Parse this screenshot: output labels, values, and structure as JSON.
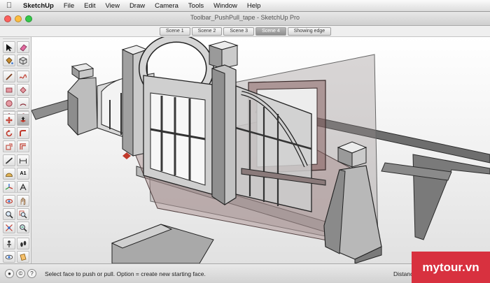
{
  "menubar": {
    "app": "SketchUp",
    "items": [
      {
        "label": "File"
      },
      {
        "label": "Edit"
      },
      {
        "label": "View"
      },
      {
        "label": "Draw"
      },
      {
        "label": "Camera"
      },
      {
        "label": "Tools"
      },
      {
        "label": "Window"
      },
      {
        "label": "Help"
      }
    ]
  },
  "window": {
    "title": "Toolbar_PushPull_tape - SketchUp Pro"
  },
  "scenes": {
    "tabs": [
      {
        "label": "Scene 1"
      },
      {
        "label": "Scene 2"
      },
      {
        "label": "Scene 3"
      },
      {
        "label": "Scene 4"
      },
      {
        "label": "Showing edge"
      }
    ],
    "active_index": 3
  },
  "toolbar": {
    "tools": [
      "select-icon",
      "eraser-icon",
      "paint-bucket-icon",
      "make-component-icon",
      "line-icon",
      "freehand-icon",
      "rectangle-icon",
      "rotated-rectangle-icon",
      "circle-icon",
      "arc-icon",
      "polygon-icon",
      "pie-icon",
      "move-icon",
      "push-pull-icon",
      "rotate-icon",
      "follow-me-icon",
      "scale-icon",
      "offset-icon",
      "tape-measure-icon",
      "dimension-icon",
      "protractor-icon",
      "text-icon",
      "axes-icon",
      "3d-text-icon",
      "orbit-icon",
      "pan-icon",
      "zoom-icon",
      "zoom-window-icon",
      "zoom-extents-icon",
      "previous-view-icon",
      "position-camera-icon",
      "walk-icon",
      "look-around-icon",
      "section-plane-icon"
    ],
    "selected": "push-pull-icon",
    "text_tool_label": "A1"
  },
  "status": {
    "help_text": "Select face to push or pull.  Option = create new starting face.",
    "measurement_label": "Distance"
  },
  "watermark": {
    "text": "mytour.vn"
  },
  "colors": {
    "accent": "#d8313f",
    "traffic_close": "#fc615d",
    "traffic_min": "#fdbc40",
    "traffic_max": "#34c84a"
  }
}
